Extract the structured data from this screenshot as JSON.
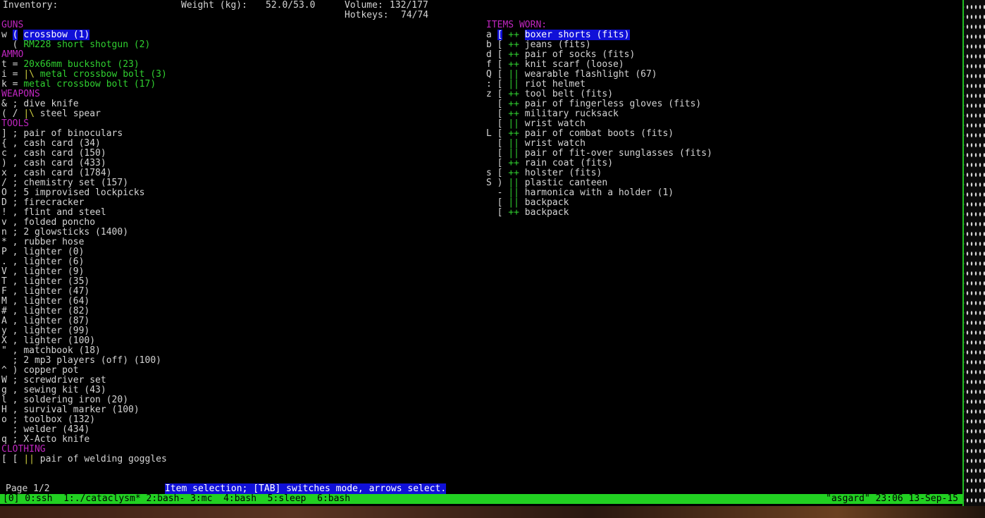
{
  "header": {
    "inventory_label": "Inventory:",
    "weight_label": "Weight (kg):",
    "weight_value": "52.0/53.0",
    "volume_label": "Volume:",
    "volume_value": "132/177",
    "hotkeys_label": "Hotkeys:",
    "hotkeys_value": "74/74"
  },
  "left": [
    {
      "type": "cat",
      "text": "GUNS"
    },
    {
      "type": "item",
      "key": "w",
      "sym": "(",
      "mark": "",
      "name": "crossbow (1)",
      "color": "sel"
    },
    {
      "type": "item",
      "key": " ",
      "sym": "(",
      "mark": "",
      "name": "RM228 short shotgun (2)",
      "color": "g"
    },
    {
      "type": "cat",
      "text": "AMMO"
    },
    {
      "type": "item",
      "key": "t",
      "sym": "=",
      "mark": "",
      "name": "20x66mm buckshot (23)",
      "color": "g"
    },
    {
      "type": "item",
      "key": "i",
      "sym": "=",
      "mark": "|\\",
      "name": "metal crossbow bolt (3)",
      "color": "g"
    },
    {
      "type": "item",
      "key": "k",
      "sym": "=",
      "mark": "",
      "name": "metal crossbow bolt (17)",
      "color": "g"
    },
    {
      "type": "cat",
      "text": "WEAPONS"
    },
    {
      "type": "item",
      "key": "&",
      "sym": ";",
      "mark": "",
      "name": "dive knife",
      "color": "w"
    },
    {
      "type": "item",
      "key": "(",
      "sym": "/",
      "mark": "|\\",
      "name": "steel spear",
      "color": "w"
    },
    {
      "type": "cat",
      "text": "TOOLS"
    },
    {
      "type": "item",
      "key": "]",
      "sym": ";",
      "mark": "",
      "name": "pair of binoculars",
      "color": "w"
    },
    {
      "type": "item",
      "key": "{",
      "sym": ",",
      "mark": "",
      "name": "cash card (34)",
      "color": "w"
    },
    {
      "type": "item",
      "key": "c",
      "sym": ",",
      "mark": "",
      "name": "cash card (150)",
      "color": "w"
    },
    {
      "type": "item",
      "key": ")",
      "sym": ",",
      "mark": "",
      "name": "cash card (433)",
      "color": "w"
    },
    {
      "type": "item",
      "key": "x",
      "sym": ",",
      "mark": "",
      "name": "cash card (1784)",
      "color": "w"
    },
    {
      "type": "item",
      "key": "/",
      "sym": ";",
      "mark": "",
      "name": "chemistry set (157)",
      "color": "w"
    },
    {
      "type": "item",
      "key": "O",
      "sym": ";",
      "mark": "",
      "name": "5 improvised lockpicks",
      "color": "w"
    },
    {
      "type": "item",
      "key": "D",
      "sym": ";",
      "mark": "",
      "name": "firecracker",
      "color": "w"
    },
    {
      "type": "item",
      "key": "!",
      "sym": ",",
      "mark": "",
      "name": "flint and steel",
      "color": "w"
    },
    {
      "type": "item",
      "key": "v",
      "sym": ",",
      "mark": "",
      "name": "folded poncho",
      "color": "w"
    },
    {
      "type": "item",
      "key": "n",
      "sym": ";",
      "mark": "",
      "name": "2 glowsticks (1400)",
      "color": "w"
    },
    {
      "type": "item",
      "key": "*",
      "sym": ",",
      "mark": "",
      "name": "rubber hose",
      "color": "w"
    },
    {
      "type": "item",
      "key": "P",
      "sym": ",",
      "mark": "",
      "name": "lighter (0)",
      "color": "w"
    },
    {
      "type": "item",
      "key": ".",
      "sym": ",",
      "mark": "",
      "name": "lighter (6)",
      "color": "w"
    },
    {
      "type": "item",
      "key": "V",
      "sym": ",",
      "mark": "",
      "name": "lighter (9)",
      "color": "w"
    },
    {
      "type": "item",
      "key": "T",
      "sym": ",",
      "mark": "",
      "name": "lighter (35)",
      "color": "w"
    },
    {
      "type": "item",
      "key": "F",
      "sym": ",",
      "mark": "",
      "name": "lighter (47)",
      "color": "w"
    },
    {
      "type": "item",
      "key": "M",
      "sym": ",",
      "mark": "",
      "name": "lighter (64)",
      "color": "w"
    },
    {
      "type": "item",
      "key": "#",
      "sym": ",",
      "mark": "",
      "name": "lighter (82)",
      "color": "w"
    },
    {
      "type": "item",
      "key": "A",
      "sym": ",",
      "mark": "",
      "name": "lighter (87)",
      "color": "w"
    },
    {
      "type": "item",
      "key": "y",
      "sym": ",",
      "mark": "",
      "name": "lighter (99)",
      "color": "w"
    },
    {
      "type": "item",
      "key": "X",
      "sym": ",",
      "mark": "",
      "name": "lighter (100)",
      "color": "w"
    },
    {
      "type": "item",
      "key": "\"",
      "sym": ",",
      "mark": "",
      "name": "matchbook (18)",
      "color": "w"
    },
    {
      "type": "item",
      "key": " ",
      "sym": ";",
      "mark": "",
      "name": "2 mp3 players (off) (100)",
      "color": "w"
    },
    {
      "type": "item",
      "key": "^",
      "sym": ")",
      "mark": "",
      "name": "copper pot",
      "color": "w"
    },
    {
      "type": "item",
      "key": "W",
      "sym": ";",
      "mark": "",
      "name": "screwdriver set",
      "color": "w"
    },
    {
      "type": "item",
      "key": "g",
      "sym": ",",
      "mark": "",
      "name": "sewing kit (43)",
      "color": "w"
    },
    {
      "type": "item",
      "key": "l",
      "sym": ",",
      "mark": "",
      "name": "soldering iron (20)",
      "color": "w"
    },
    {
      "type": "item",
      "key": "H",
      "sym": ",",
      "mark": "",
      "name": "survival marker (100)",
      "color": "w"
    },
    {
      "type": "item",
      "key": "o",
      "sym": ";",
      "mark": "",
      "name": "toolbox (132)",
      "color": "w"
    },
    {
      "type": "item",
      "key": " ",
      "sym": ";",
      "mark": "",
      "name": "welder (434)",
      "color": "w"
    },
    {
      "type": "item",
      "key": "q",
      "sym": ";",
      "mark": "",
      "name": "X-Acto knife",
      "color": "w"
    },
    {
      "type": "cat",
      "text": "CLOTHING"
    },
    {
      "type": "item",
      "key": "[",
      "sym": "[",
      "mark": "||",
      "name": "pair of welding goggles",
      "color": "w"
    }
  ],
  "right_title": "ITEMS WORN:",
  "right": [
    {
      "key": "a",
      "sym": "[",
      "mark": "++",
      "name": "boxer shorts (fits)",
      "color": "sel"
    },
    {
      "key": "b",
      "sym": "[",
      "mark": "++",
      "name": "jeans (fits)",
      "color": "w"
    },
    {
      "key": "d",
      "sym": "[",
      "mark": "++",
      "name": "pair of socks (fits)",
      "color": "w"
    },
    {
      "key": "f",
      "sym": "[",
      "mark": "++",
      "name": "knit scarf (loose)",
      "color": "w"
    },
    {
      "key": "Q",
      "sym": "[",
      "mark": "||",
      "name": "wearable flashlight (67)",
      "color": "w"
    },
    {
      "key": ":",
      "sym": "[",
      "mark": "||",
      "name": "riot helmet",
      "color": "w"
    },
    {
      "key": "z",
      "sym": "[",
      "mark": "++",
      "name": "tool belt (fits)",
      "color": "w"
    },
    {
      "key": " ",
      "sym": "[",
      "mark": "++",
      "name": "pair of fingerless gloves (fits)",
      "color": "w"
    },
    {
      "key": " ",
      "sym": "[",
      "mark": "++",
      "name": "military rucksack",
      "color": "w"
    },
    {
      "key": " ",
      "sym": "[",
      "mark": "||",
      "name": "wrist watch",
      "color": "w"
    },
    {
      "key": "L",
      "sym": "[",
      "mark": "++",
      "name": "pair of combat boots (fits)",
      "color": "w"
    },
    {
      "key": " ",
      "sym": "[",
      "mark": "||",
      "name": "wrist watch",
      "color": "w"
    },
    {
      "key": " ",
      "sym": "[",
      "mark": "||",
      "name": "pair of fit-over sunglasses (fits)",
      "color": "w"
    },
    {
      "key": " ",
      "sym": "[",
      "mark": "++",
      "name": "rain coat (fits)",
      "color": "w"
    },
    {
      "key": "s",
      "sym": "[",
      "mark": "++",
      "name": "holster (fits)",
      "color": "w"
    },
    {
      "key": "S",
      "sym": ")",
      "mark": "||",
      "name": "plastic canteen",
      "color": "w"
    },
    {
      "key": " ",
      "sym": "-",
      "mark": "||",
      "name": "harmonica with a holder (1)",
      "color": "w"
    },
    {
      "key": " ",
      "sym": "[",
      "mark": "||",
      "name": "backpack",
      "color": "w"
    },
    {
      "key": " ",
      "sym": "[",
      "mark": "++",
      "name": "backpack",
      "color": "w"
    }
  ],
  "footer": {
    "page": "Page 1/2",
    "hint": "Item selection; [TAB] switches mode, arrows select."
  },
  "tmux": {
    "left": "[0] 0:ssh  1:./cataclysm* 2:bash- 3:mc  4:bash  5:sleep  6:bash",
    "right": "\"asgard\" 23:06 13-Sep-15"
  },
  "colors": {
    "category": "#c026c0",
    "selection_bg": "#1010d8",
    "item_green": "#30d030",
    "status_bar": "#22d022"
  }
}
